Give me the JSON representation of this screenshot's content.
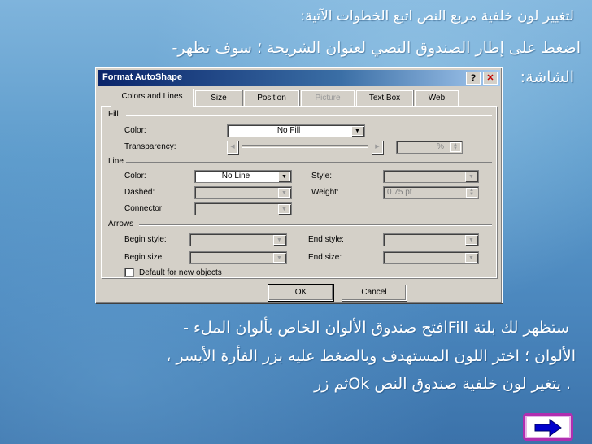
{
  "slide": {
    "title": "لتغيير لون خلفية مربع النص اتبع الخطوات الآتية:",
    "step1_line1": "اضغط على إطار الصندوق النصي لعنوان الشريحة ؛ سوف تظهر-",
    "step1_line2": "الشاشة:",
    "step2_line1": "ستظهر لك بلتة Fillافتح صندوق الألوان الخاص بألوان الملء   -",
    "step2_line2": "الألوان ؛ اختر اللون المستهدف وبالضغط عليه بزر الفأرة الأيسر ،",
    "step2_line3": ". يتغير لون خلفية صندوق النص  Okثم زر"
  },
  "dialog": {
    "title": "Format AutoShape",
    "help_label": "?",
    "close_label": "✕",
    "tabs": [
      {
        "label": "Colors and Lines",
        "active": true,
        "disabled": false
      },
      {
        "label": "Size",
        "active": false,
        "disabled": false
      },
      {
        "label": "Position",
        "active": false,
        "disabled": false
      },
      {
        "label": "Picture",
        "active": false,
        "disabled": true
      },
      {
        "label": "Text Box",
        "active": false,
        "disabled": false
      },
      {
        "label": "Web",
        "active": false,
        "disabled": false
      }
    ],
    "fill": {
      "section": "Fill",
      "color_label": "Color:",
      "color_value": "No Fill",
      "transparency_label": "Transparency:",
      "transparency_value": "%"
    },
    "line": {
      "section": "Line",
      "color_label": "Color:",
      "color_value": "No Line",
      "style_label": "Style:",
      "dashed_label": "Dashed:",
      "weight_label": "Weight:",
      "weight_value": "0.75 pt",
      "connector_label": "Connector:"
    },
    "arrows": {
      "section": "Arrows",
      "begin_style_label": "Begin style:",
      "end_style_label": "End style:",
      "begin_size_label": "Begin size:",
      "end_size_label": "End size:"
    },
    "default_checkbox_label": "Default for new objects",
    "ok_label": "OK",
    "cancel_label": "Cancel"
  },
  "colors": {
    "accent": "#b02eb0",
    "titlebar": "#0a246a",
    "arrow_fill": "#0000cc"
  },
  "icons": {
    "next": "right-arrow-icon"
  }
}
